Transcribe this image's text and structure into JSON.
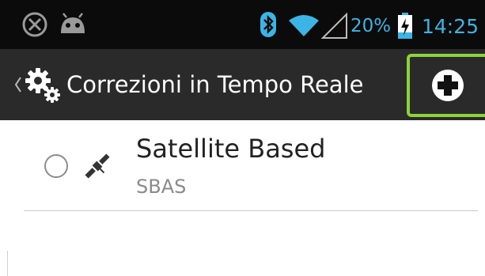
{
  "status_bar": {
    "battery_percent": "20%",
    "time": "14:25",
    "icons": [
      "blocked-circle-icon",
      "android-icon",
      "bluetooth-icon",
      "wifi-icon",
      "cell-signal-icon",
      "battery-charging-icon"
    ],
    "text_color": "#3cb4e6"
  },
  "action_bar": {
    "title": "Correzioni in Tempo Reale",
    "up_icon": "chevron-left-icon",
    "app_icon": "gears-icon",
    "add_action_icon": "add-circle-icon",
    "highlight_color": "#8ed23a"
  },
  "list": {
    "items": [
      {
        "title": "Satellite Based",
        "subtitle": "SBAS",
        "icon": "satellite-icon",
        "selected": false
      }
    ]
  }
}
